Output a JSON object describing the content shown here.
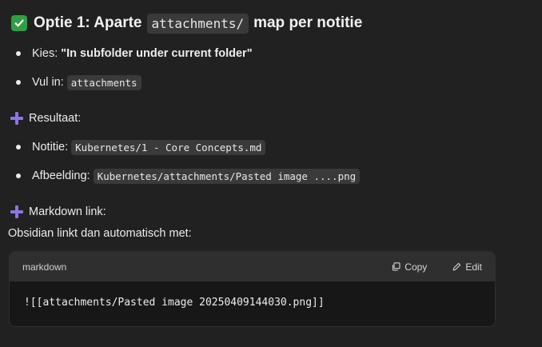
{
  "heading": {
    "prefix": "Optie 1: Aparte",
    "code": "attachments/",
    "suffix": "map per notitie"
  },
  "steps": [
    {
      "label": "Kies:",
      "value": "\"In subfolder under current folder\""
    },
    {
      "label": "Vul in:",
      "code": "attachments"
    }
  ],
  "result": {
    "title": "Resultaat:",
    "items": [
      {
        "label": "Notitie:",
        "code": "Kubernetes/1 - Core Concepts.md"
      },
      {
        "label": "Afbeelding:",
        "code": "Kubernetes/attachments/Pasted image ....png"
      }
    ]
  },
  "markdown_link": {
    "title": "Markdown link:",
    "description": "Obsidian linkt dan automatisch met:"
  },
  "code_block": {
    "language": "markdown",
    "copy_label": "Copy",
    "edit_label": "Edit",
    "code": "![[attachments/Pasted image 20250409144030.png]]"
  },
  "icons": {
    "heading": "check-box-icon",
    "section": "plus-icon",
    "copy": "copy-icon",
    "edit": "edit-pencil-icon"
  },
  "colors": {
    "background": "#212121",
    "check": "#2ea043",
    "plus": "#8e75e0",
    "code_header": "#2f2f2f",
    "code_body": "#171717"
  }
}
